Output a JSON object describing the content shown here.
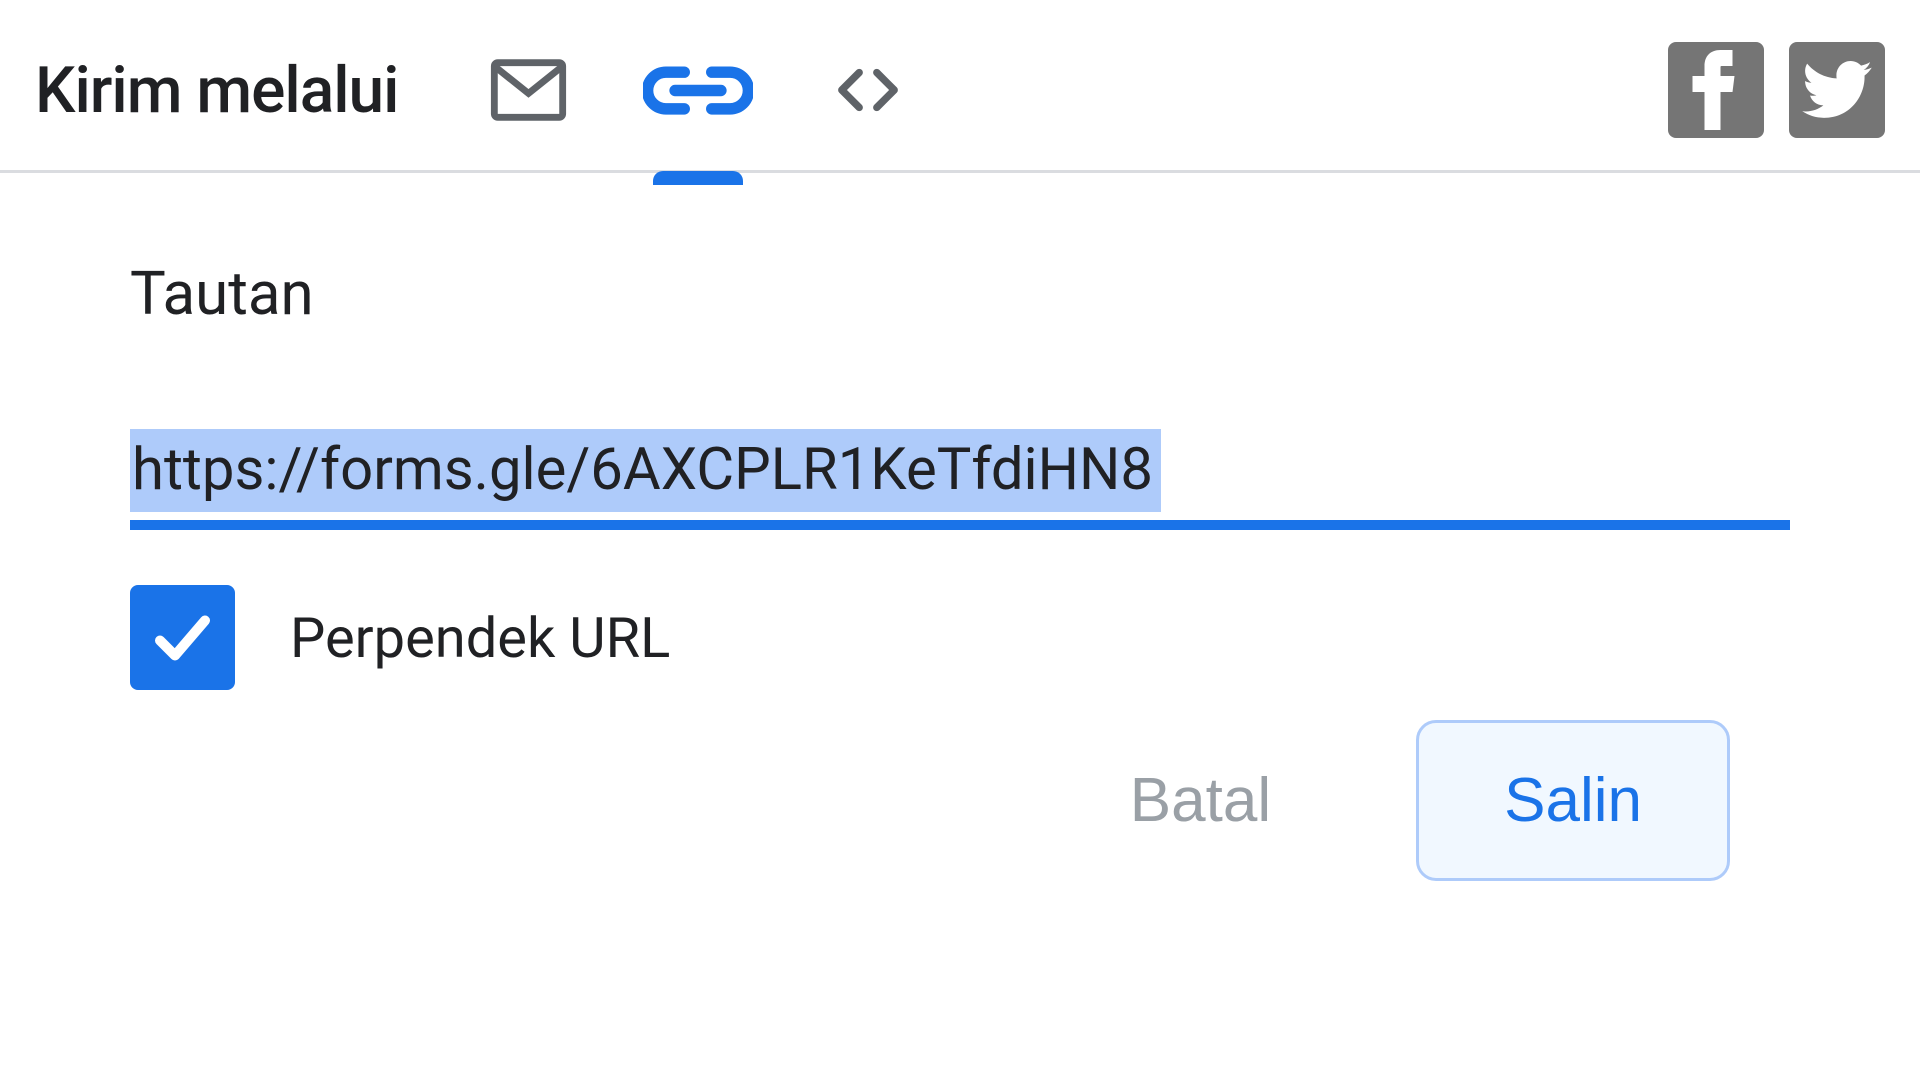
{
  "header": {
    "send_via_label": "Kirim melalui",
    "active_tab": "link"
  },
  "content": {
    "section_title": "Tautan",
    "url_value": "https://forms.gle/6AXCPLR1KeTfdiHN8",
    "shorten_url_label": "Perpendek URL",
    "shorten_url_checked": true
  },
  "buttons": {
    "cancel_label": "Batal",
    "copy_label": "Salin"
  },
  "colors": {
    "accent": "#1a73e8",
    "selection": "#aecbfa",
    "muted": "#9aa0a6",
    "social_bg": "#757575"
  }
}
